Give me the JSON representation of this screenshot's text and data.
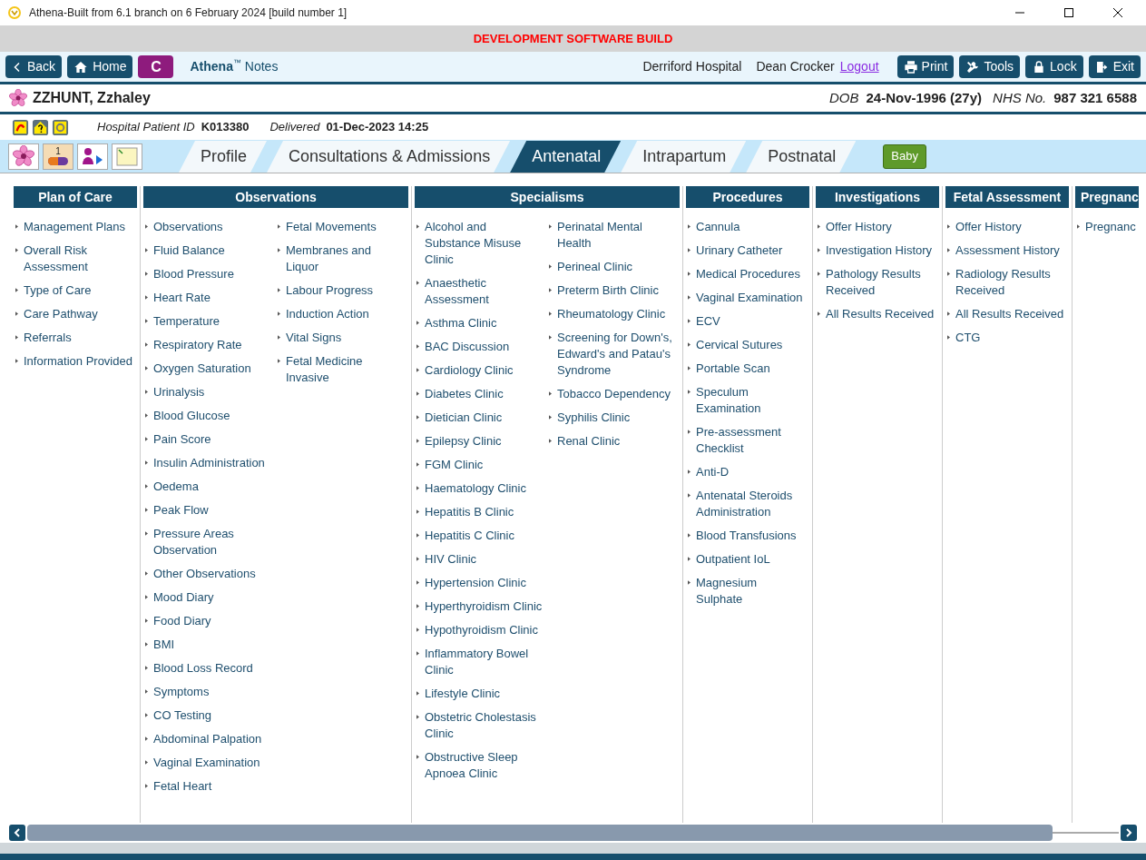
{
  "window": {
    "title": "Athena-Built from 6.1 branch on 6 February 2024 [build number 1]"
  },
  "banner": "DEVELOPMENT SOFTWARE BUILD",
  "toolbar": {
    "left": [
      {
        "label": "Back",
        "kind": "back"
      },
      {
        "label": "Home",
        "kind": "home"
      },
      {
        "label": "C",
        "kind": "letter"
      }
    ],
    "app_name": "Athena",
    "app_mark": "™",
    "app_suffix": "Notes",
    "hospital": "Derriford Hospital",
    "user": "Dean Crocker",
    "logout": "Logout",
    "right": [
      {
        "label": "Print",
        "kind": "print"
      },
      {
        "label": "Tools",
        "kind": "tools"
      },
      {
        "label": "Lock",
        "kind": "lock"
      },
      {
        "label": "Exit",
        "kind": "exit"
      }
    ]
  },
  "patient": {
    "name": "ZZHUNT, Zzhaley",
    "dob_label": "DOB",
    "dob": "24-Nov-1996 (27y)",
    "nhs_label": "NHS No.",
    "nhs": "987 321 6588"
  },
  "info": {
    "id_label": "Hospital Patient ID",
    "id": "K013380",
    "delivered_label": "Delivered",
    "delivered": "01-Dec-2023 14:25"
  },
  "pill_count": "1",
  "tabs": [
    {
      "label": "Profile",
      "selected": false
    },
    {
      "label": "Consultations & Admissions",
      "selected": false
    },
    {
      "label": "Antenatal",
      "selected": true
    },
    {
      "label": "Intrapartum",
      "selected": false
    },
    {
      "label": "Postnatal",
      "selected": false
    }
  ],
  "baby_button": "Baby",
  "sections": [
    {
      "title": "Plan of Care",
      "columns": [
        [
          "Management Plans",
          "Overall Risk Assessment",
          "Type of Care",
          "Care Pathway",
          "Referrals",
          "Information Provided"
        ]
      ]
    },
    {
      "title": "Observations",
      "columns": [
        [
          "Observations",
          "Fluid Balance",
          "Blood Pressure",
          "Heart Rate",
          "Temperature",
          "Respiratory Rate",
          "Oxygen Saturation",
          "Urinalysis",
          "Blood Glucose",
          "Pain Score",
          "Insulin Administration",
          "Oedema",
          "Peak Flow",
          "Pressure Areas Observation",
          "Other Observations",
          "Mood Diary",
          "Food Diary",
          "BMI",
          "Blood Loss Record",
          "Symptoms",
          "CO Testing",
          "Abdominal Palpation",
          "Vaginal Examination",
          "Fetal Heart"
        ],
        [
          "Fetal Movements",
          "Membranes and Liquor",
          "Labour Progress",
          "Induction Action",
          "Vital Signs",
          "Fetal Medicine Invasive"
        ]
      ]
    },
    {
      "title": "Specialisms",
      "columns": [
        [
          "Alcohol and Substance Misuse Clinic",
          "Anaesthetic Assessment",
          "Asthma Clinic",
          "BAC Discussion",
          "Cardiology Clinic",
          "Diabetes Clinic",
          "Dietician Clinic",
          "Epilepsy Clinic",
          "FGM Clinic",
          "Haematology Clinic",
          "Hepatitis B Clinic",
          "Hepatitis C Clinic",
          "HIV Clinic",
          "Hypertension Clinic",
          "Hyperthyroidism Clinic",
          "Hypothyroidism Clinic",
          "Inflammatory Bowel Clinic",
          "Lifestyle Clinic",
          "Obstetric Cholestasis Clinic",
          "Obstructive Sleep Apnoea Clinic"
        ],
        [
          "Perinatal Mental Health",
          "Perineal Clinic",
          "Preterm Birth Clinic",
          "Rheumatology Clinic",
          "Screening for Down's, Edward's and Patau's Syndrome",
          "Tobacco Dependency",
          "Syphilis Clinic",
          "Renal Clinic"
        ]
      ]
    },
    {
      "title": "Procedures",
      "columns": [
        [
          "Cannula",
          "Urinary Catheter",
          "Medical Procedures",
          "Vaginal Examination",
          "ECV",
          "Cervical Sutures",
          "Portable Scan",
          "Speculum Examination",
          "Pre-assessment Checklist",
          "Anti-D",
          "Antenatal Steroids Administration",
          "Blood Transfusions",
          "Outpatient IoL",
          "Magnesium Sulphate"
        ]
      ]
    },
    {
      "title": "Investigations",
      "columns": [
        [
          "Offer History",
          "Investigation History",
          "Pathology Results Received",
          "All Results Received"
        ]
      ]
    },
    {
      "title": "Fetal Assessment",
      "columns": [
        [
          "Offer History",
          "Assessment History",
          "Radiology Results Received",
          "All Results Received",
          "CTG"
        ]
      ]
    },
    {
      "title": "Pregnanc",
      "clipped": true,
      "columns": [
        [
          "Pregnanc"
        ]
      ]
    }
  ]
}
